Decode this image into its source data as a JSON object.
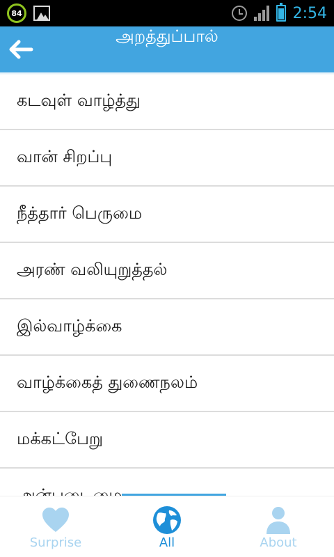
{
  "status_bar": {
    "battery_ring_value": "84",
    "clock": "2:54",
    "icons": [
      "battery-ring-icon",
      "gallery-icon",
      "alarm-icon",
      "signal-icon",
      "battery-icon"
    ]
  },
  "action_bar": {
    "title": "அறத்துப்பால்",
    "back_icon": "arrow-left-icon"
  },
  "chapters": [
    "கடவுள் வாழ்த்து",
    "வான் சிறப்பு",
    "நீத்தார் பெருமை",
    "அரண் வலியுறுத்தல்",
    "இல்வாழ்க்கை",
    "வாழ்க்கைத் துணைநலம்",
    "மக்கட்பேறு",
    "அன்புடைமை"
  ],
  "bottom_nav": {
    "tabs": [
      {
        "label": "Surprise",
        "icon": "heart-icon",
        "active": false
      },
      {
        "label": "All",
        "icon": "globe-icon",
        "active": true
      },
      {
        "label": "About",
        "icon": "person-icon",
        "active": false
      }
    ]
  },
  "colors": {
    "action_bar": "#42a5e0",
    "active_tab": "#1e8fd8",
    "inactive_tab": "#a9d4f0",
    "divider": "#dcdcdc"
  }
}
